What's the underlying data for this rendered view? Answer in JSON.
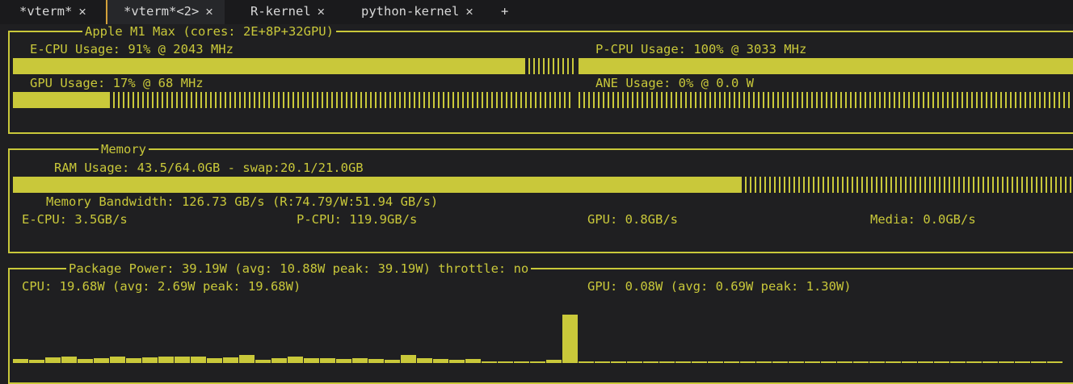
{
  "tabs": [
    {
      "label": "*vterm*",
      "close": "✕",
      "active": false
    },
    {
      "label": "*vterm*<2>",
      "close": "✕",
      "active": true
    },
    {
      "label": "R-kernel",
      "close": "✕",
      "active": false
    },
    {
      "label": "python-kernel",
      "close": "✕",
      "active": false
    }
  ],
  "tab_add": "+",
  "cpu_panel": {
    "title": "Apple M1 Max (cores: 2E+8P+32GPU)",
    "ecpu": {
      "label": "E-CPU Usage: 91% @ 2043 MHz",
      "level": 0.91
    },
    "pcpu": {
      "label": "P-CPU Usage: 100% @ 3033 MHz",
      "level": 1.0
    },
    "gpu": {
      "label": "GPU Usage: 17% @ 68 MHz",
      "level": 0.17
    },
    "ane": {
      "label": "ANE Usage: 0% @ 0.0 W",
      "level": 0.0
    }
  },
  "memory_panel": {
    "title": "Memory",
    "ram": {
      "label": "RAM Usage: 43.5/64.0GB - swap:20.1/21.0GB",
      "level": 0.68
    },
    "bandwidth": "Memory Bandwidth: 126.73 GB/s (R:74.79/W:51.94 GB/s)",
    "ecpu": "E-CPU: 3.5GB/s",
    "pcpu": "P-CPU: 119.9GB/s",
    "gpu": "GPU: 0.8GB/s",
    "media": "Media: 0.0GB/s"
  },
  "power_panel": {
    "title": "Package Power: 39.19W (avg: 10.88W peak: 39.19W) throttle: no",
    "cpu": "CPU: 19.68W (avg: 2.69W peak: 19.68W)",
    "gpu": "GPU: 0.08W (avg: 0.69W peak: 1.30W)",
    "history": [
      0.08,
      0.06,
      0.12,
      0.14,
      0.08,
      0.1,
      0.14,
      0.1,
      0.12,
      0.14,
      0.14,
      0.14,
      0.1,
      0.12,
      0.16,
      0.06,
      0.1,
      0.14,
      0.1,
      0.1,
      0.08,
      0.1,
      0.08,
      0.06,
      0.16,
      0.1,
      0.08,
      0.06,
      0.08,
      0.04,
      0.04,
      0.04,
      0.04,
      0.06,
      1.0,
      0.04,
      0.04,
      0.04,
      0.04,
      0.04,
      0.04,
      0.04,
      0.04,
      0.04,
      0.04,
      0.04,
      0.04,
      0.04,
      0.04,
      0.04,
      0.04,
      0.04,
      0.04,
      0.04,
      0.04,
      0.04,
      0.04,
      0.04,
      0.04,
      0.04,
      0.04,
      0.04,
      0.04,
      0.04,
      0.04
    ]
  },
  "colors": {
    "accent": "#c9c83a",
    "background": "#1f1f21",
    "tab_active_border": "#d4a13a"
  }
}
